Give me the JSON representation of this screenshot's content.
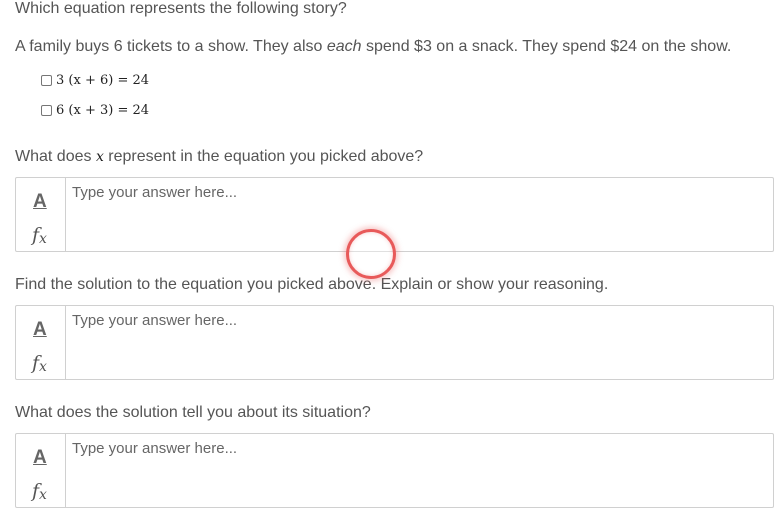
{
  "prompt": {
    "heading": "Which equation represents the following story?",
    "story_before": "A family buys 6 tickets to a show. They also ",
    "story_emph": "each",
    "story_after": " spend $3 on a snack. They spend $24 on the show."
  },
  "choices": [
    {
      "label": "3 (x + 6) = 24",
      "checked": false
    },
    {
      "label": "6 (x + 3) = 24",
      "checked": false
    }
  ],
  "questions": {
    "q1_before": "What does ",
    "q1_var": "x",
    "q1_after": " represent in the equation you picked above?",
    "q2": "Find the solution to the equation you picked above.  Explain or show your reasoning.",
    "q3": "What does the solution tell you about its situation?"
  },
  "answer": {
    "placeholder": "Type your answer here...",
    "format_icon_label": "A",
    "fx_icon_label": "f",
    "fx_sub": "x"
  },
  "icons": {
    "format": "text-format-icon",
    "function": "fx-icon",
    "cursor": "click-indicator"
  },
  "colors": {
    "text": "#555555",
    "border": "#d0d0d0",
    "cursor_ring": "#e85a5a"
  }
}
